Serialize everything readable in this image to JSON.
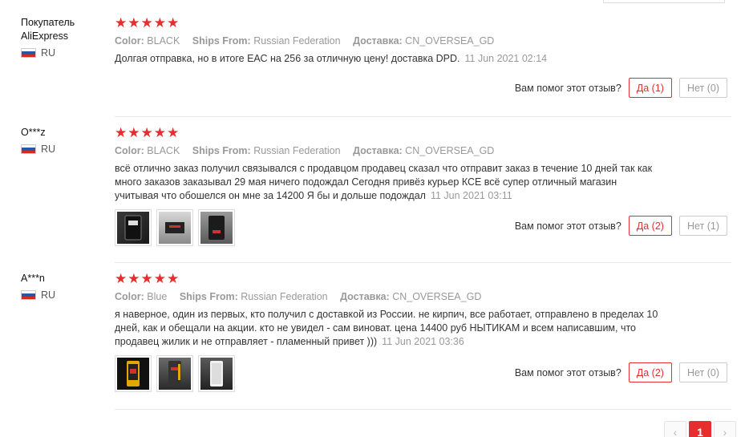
{
  "reviews": [
    {
      "user": "Покупатель AliExpress",
      "country": "RU",
      "stars": "★★★★★",
      "color_label": "Color:",
      "color": "BLACK",
      "ships_label": "Ships From:",
      "ships": "Russian Federation",
      "delivery_label": "Доставка:",
      "delivery": "CN_OVERSEA_GD",
      "text": "Долгая отправка, но в итоге ЕАС на 256 за отличную цену! доставка DPD.",
      "date": "11 Jun 2021 02:14",
      "helpful_q": "Вам помог этот отзыв?",
      "yes": "Да (1)",
      "no": "Нет (0)"
    },
    {
      "user": "O***z",
      "country": "RU",
      "stars": "★★★★★",
      "color_label": "Color:",
      "color": "BLACK",
      "ships_label": "Ships From:",
      "ships": "Russian Federation",
      "delivery_label": "Доставка:",
      "delivery": "CN_OVERSEA_GD",
      "text": "всё отлично заказ получил связывался с продавцом продавец сказал что отправит заказ в течение 10 дней так как много заказов заказывал 29 мая ничего подождал Сегодня привёз курьер КСЕ всё супер отличный магазин учитывая что обошелся он мне за 14200 Я бы и дольше подождал",
      "date": "11 Jun 2021 03:11",
      "helpful_q": "Вам помог этот отзыв?",
      "yes": "Да (2)",
      "no": "Нет (1)"
    },
    {
      "user": "A***n",
      "country": "RU",
      "stars": "★★★★★",
      "color_label": "Color:",
      "color": "Blue",
      "ships_label": "Ships From:",
      "ships": "Russian Federation",
      "delivery_label": "Доставка:",
      "delivery": "CN_OVERSEA_GD",
      "text": "я наверное, один из первых, кто получил с доставкой из России. не кирпич, все работает, отправлено в пределах 10 дней, как и обещали на акции. кто не увидел - сам виноват. цена 14400 руб НЫТИКАМ и всем написавшим, что продавец жилик и не отправляет - пламенный привет )))",
      "date": "11 Jun 2021 03:36",
      "helpful_q": "Вам помог этот отзыв?",
      "yes": "Да (2)",
      "no": "Нет (0)"
    }
  ],
  "pagination": {
    "prev": "‹",
    "current": "1",
    "next": "›"
  },
  "colors": {
    "accent": "#e62e2e",
    "muted": "#999999"
  }
}
